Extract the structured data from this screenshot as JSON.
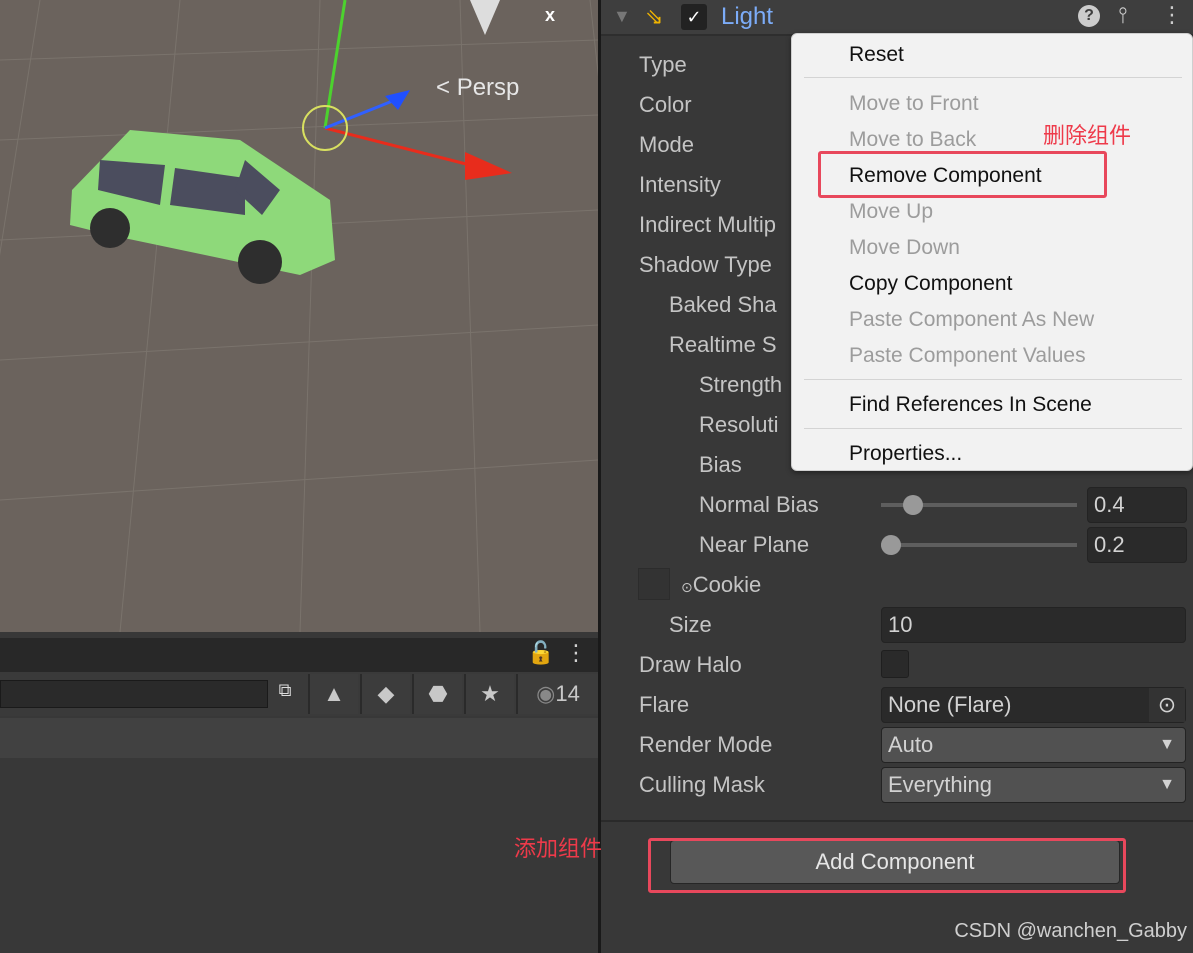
{
  "scene": {
    "view_label": "Persp",
    "axis_label": "x"
  },
  "lower_panel": {
    "visible_count": "14"
  },
  "inspector": {
    "component_title": "Light",
    "rows": [
      {
        "label": "Type"
      },
      {
        "label": "Color"
      },
      {
        "label": "Mode"
      },
      {
        "label": "Intensity"
      },
      {
        "label": "Indirect Multip"
      },
      {
        "label": "Shadow Type"
      },
      {
        "label": "Baked Sha"
      },
      {
        "label": "Realtime S"
      },
      {
        "label": "Strength"
      },
      {
        "label": "Resoluti"
      },
      {
        "label": "Bias"
      }
    ],
    "normal_bias": {
      "label": "Normal Bias",
      "value": "0.4",
      "slider_fraction": 0.1
    },
    "near_plane": {
      "label": "Near Plane",
      "value": "0.2",
      "slider_fraction": 0.0
    },
    "cookie": {
      "label": "Cookie"
    },
    "size": {
      "label": "Size",
      "value": "10"
    },
    "draw_halo": {
      "label": "Draw Halo"
    },
    "flare": {
      "label": "Flare",
      "value": "None (Flare)"
    },
    "render_mode": {
      "label": "Render Mode",
      "value": "Auto"
    },
    "culling_mask": {
      "label": "Culling Mask",
      "value": "Everything"
    },
    "add_component": "Add Component"
  },
  "menu": {
    "items": [
      {
        "label": "Reset",
        "enabled": true
      },
      {
        "label": "Move to Front",
        "enabled": false
      },
      {
        "label": "Move to Back",
        "enabled": false
      },
      {
        "label": "Remove Component",
        "enabled": true
      },
      {
        "label": "Move Up",
        "enabled": false
      },
      {
        "label": "Move Down",
        "enabled": false
      },
      {
        "label": "Copy Component",
        "enabled": true
      },
      {
        "label": "Paste Component As New",
        "enabled": false
      },
      {
        "label": "Paste Component Values",
        "enabled": false
      },
      {
        "label": "Find References In Scene",
        "enabled": true
      },
      {
        "label": "Properties...",
        "enabled": true
      }
    ]
  },
  "annotations": {
    "remove": "删除组件",
    "add": "添加组件"
  },
  "watermark": "CSDN @wanchen_Gabby",
  "colors": {
    "accent": "#7cacf8",
    "annotation": "#e8485c"
  }
}
